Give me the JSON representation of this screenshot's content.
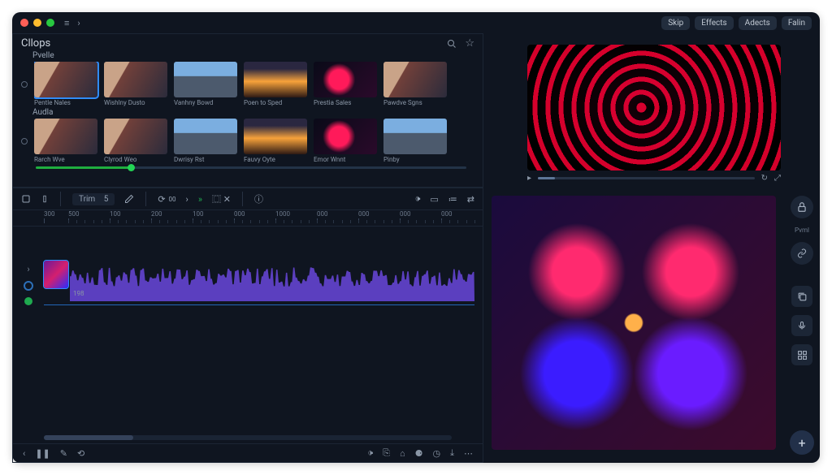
{
  "titlebar": {
    "buttons": [
      "Skip",
      "Effects",
      "Adects",
      "Falin"
    ]
  },
  "clips": {
    "title": "Cllops",
    "row1_label": "Pvelle",
    "row2_label": "Audla",
    "row1": [
      {
        "cap": "Pentle Nales",
        "sel": true,
        "cls": "portrait"
      },
      {
        "cap": "Wishlny Dusto",
        "cls": "portrait"
      },
      {
        "cap": "Vanhny Bowd",
        "cls": "city"
      },
      {
        "cap": "Poen to Sped",
        "cls": "sunset"
      },
      {
        "cap": "Prestia Sales",
        "cls": "abstract"
      },
      {
        "cap": "Pawdve Sgns",
        "cls": "portrait"
      }
    ],
    "row2": [
      {
        "cap": "Rarch Wve",
        "cls": "portrait"
      },
      {
        "cap": "Clyrod Weo",
        "cls": "portrait"
      },
      {
        "cap": "Dwrisy Rst",
        "cls": "city"
      },
      {
        "cap": "Fauvy Oyte",
        "cls": "sunset"
      },
      {
        "cap": "Emor Wnnt",
        "cls": "abstract"
      },
      {
        "cap": "Pinby",
        "cls": "city"
      }
    ],
    "slider_pct": 22
  },
  "timeline": {
    "trim_label": "Trim",
    "trim_value": "5",
    "ruler_start": "300",
    "ruler": [
      "500",
      "100",
      "200",
      "100",
      "000",
      "1000",
      "000",
      "000",
      "000",
      "000"
    ],
    "audio_marker": "198"
  },
  "sidebar": {
    "panel_label": "Pvml"
  }
}
